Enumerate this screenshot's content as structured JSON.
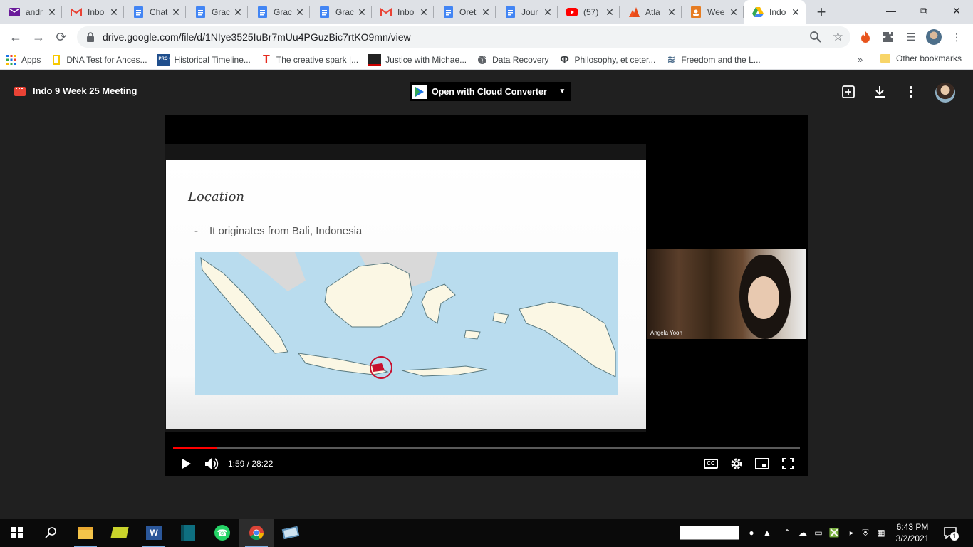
{
  "tabs": [
    {
      "title": "andr",
      "icon": "mail-icon"
    },
    {
      "title": "Inbo",
      "icon": "gmail-icon"
    },
    {
      "title": "Chat",
      "icon": "docs-icon"
    },
    {
      "title": "Grac",
      "icon": "docs-icon"
    },
    {
      "title": "Grac",
      "icon": "docs-icon"
    },
    {
      "title": "Grac",
      "icon": "docs-icon"
    },
    {
      "title": "Inbo",
      "icon": "gmail-icon"
    },
    {
      "title": "Oret",
      "icon": "docs-icon"
    },
    {
      "title": "Jour",
      "icon": "docs-icon"
    },
    {
      "title": "(57)",
      "icon": "youtube-icon"
    },
    {
      "title": "Atla",
      "icon": "atlassian-icon"
    },
    {
      "title": "Wee",
      "icon": "slides-icon"
    },
    {
      "title": "Indo",
      "icon": "drive-icon",
      "active": true
    }
  ],
  "address": {
    "url": "drive.google.com/file/d/1NIye3525IuBr7mUu4PGuzBic7rtKO9mn/view"
  },
  "bookmarks": {
    "apps": "Apps",
    "items": [
      "DNA Test for Ances...",
      "Historical Timeline...",
      "The creative spark |...",
      "Justice with Michae...",
      "Data Recovery",
      "Philosophy, et ceter...",
      "Freedom and the L..."
    ],
    "procon_badge": "PRO CON",
    "other": "Other bookmarks"
  },
  "viewer": {
    "file_title": "Indo 9 Week 25 Meeting",
    "open_with": "Open with Cloud Converter"
  },
  "slide": {
    "title": "Location",
    "bullet": "It originates from Bali, Indonesia"
  },
  "video": {
    "participant": "Angela Yoon",
    "time": "1:59 / 28:22",
    "progress_fraction": 0.07,
    "cc_label": "CC"
  },
  "taskbar": {
    "time": "6:43 PM",
    "date": "3/2/2021",
    "notifications": "1"
  },
  "colors": {
    "accent_red": "#ff0000",
    "tabstrip": "#dee1e6",
    "viewer_bg": "#202020",
    "map_water": "#b9dcee"
  }
}
